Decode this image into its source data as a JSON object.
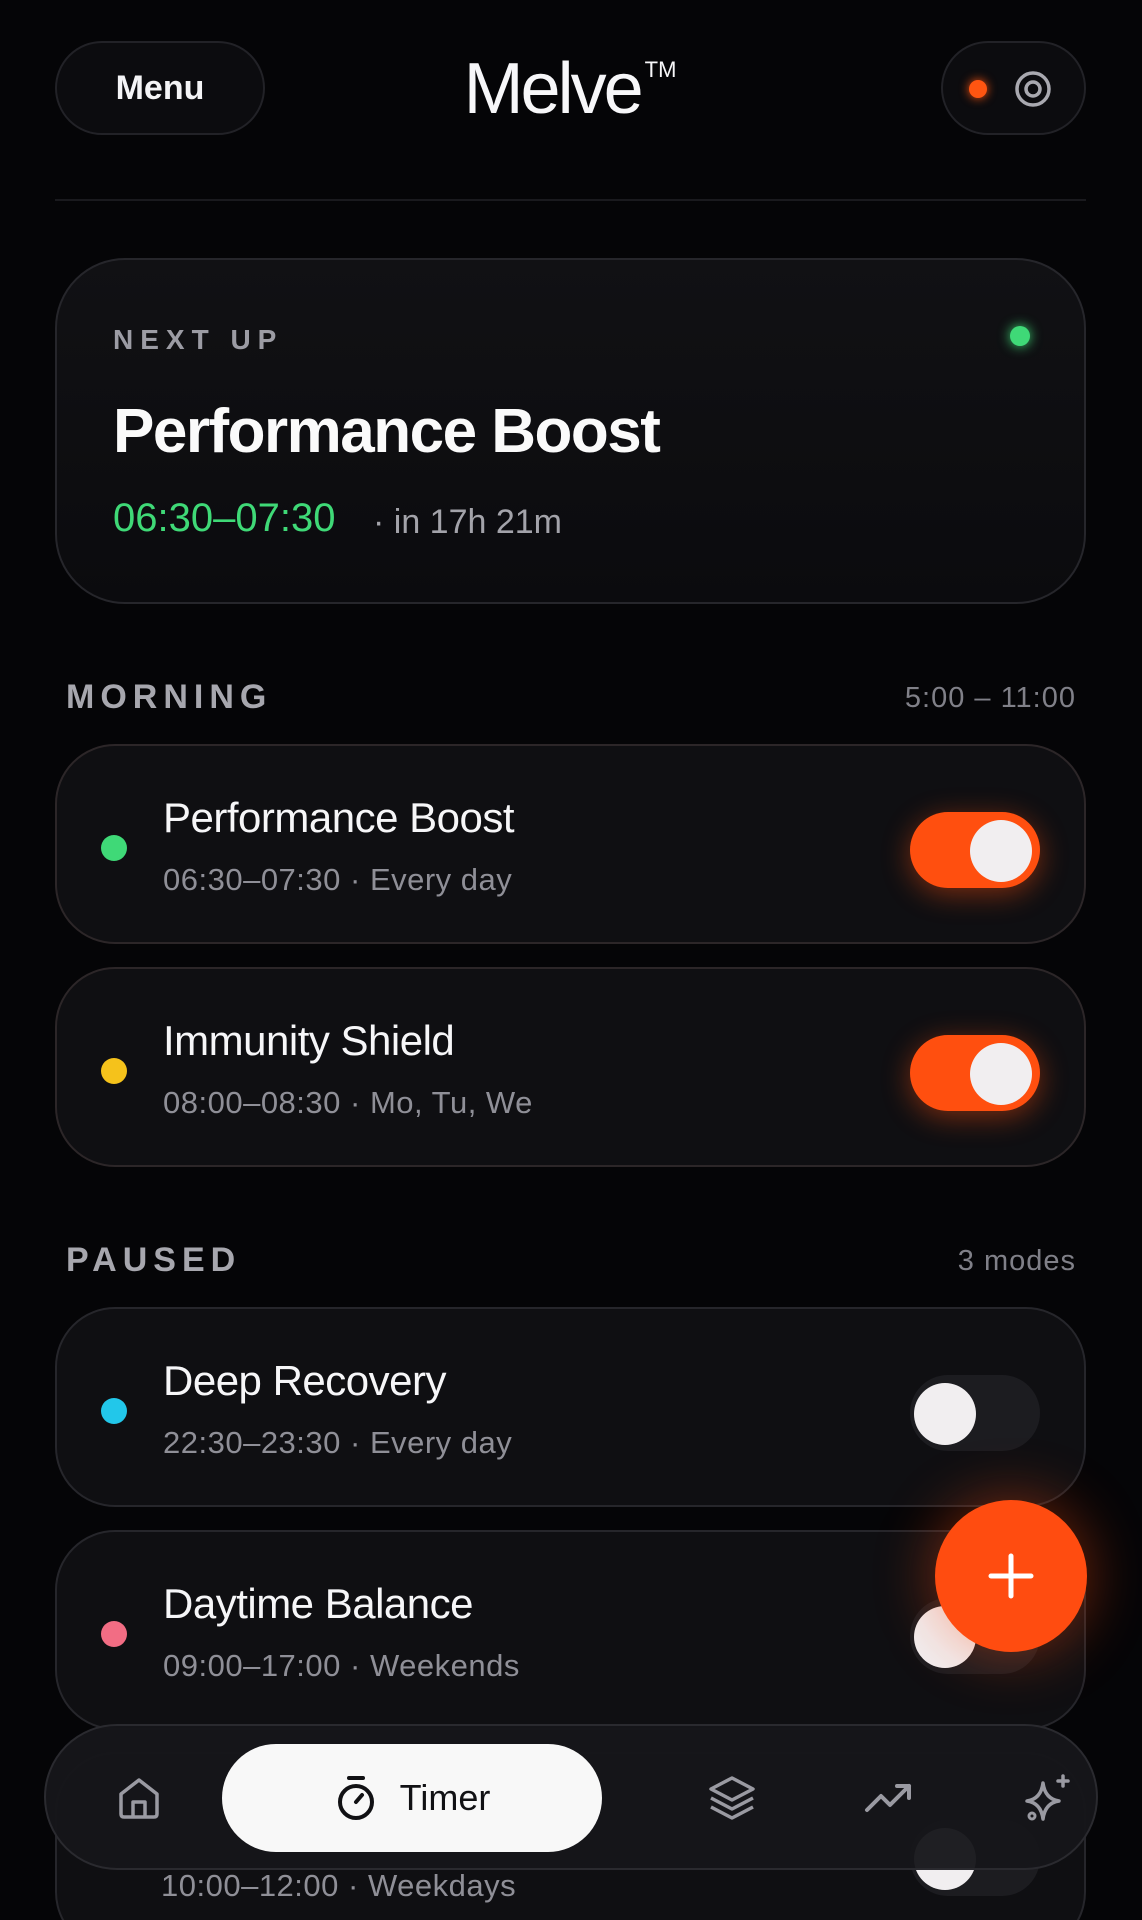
{
  "header": {
    "menu_label": "Menu",
    "logo": "Melve",
    "logo_mark": "TM",
    "status_dot_color": "#ff5511"
  },
  "next_up": {
    "label": "NEXT UP",
    "title": "Performance Boost",
    "time": "06:30–07:30",
    "in": "· in 17h 21m",
    "dot_color": "#3fd977"
  },
  "sections": [
    {
      "title": "MORNING",
      "meta": "5:00 – 11:00",
      "modes": [
        {
          "name": "Performance Boost",
          "sub": "06:30–07:30 · Every day",
          "dot_color": "#3fd977",
          "enabled": true
        },
        {
          "name": "Immunity Shield",
          "sub": "08:00–08:30 · Mo, Tu, We",
          "dot_color": "#f5c21b",
          "enabled": true
        }
      ]
    },
    {
      "title": "PAUSED",
      "meta": "3 modes",
      "modes": [
        {
          "name": "Deep Recovery",
          "sub": "22:30–23:30 · Every day",
          "dot_color": "#22c7ea",
          "enabled": false
        },
        {
          "name": "Daytime Balance",
          "sub": "09:00–17:00 · Weekends",
          "dot_color": "#f26d84",
          "enabled": false
        },
        {
          "name": "",
          "sub": "10:00–12:00 · Weekdays",
          "dot_color": "",
          "enabled": false
        }
      ]
    }
  ],
  "fab": {
    "icon": "plus-icon"
  },
  "nav": {
    "active_label": "Timer",
    "items": [
      "home-icon",
      "timer-icon",
      "layers-icon",
      "trending-up-icon",
      "sparkles-icon"
    ]
  },
  "colors": {
    "accent": "#ff4f0f",
    "background": "#050507"
  }
}
